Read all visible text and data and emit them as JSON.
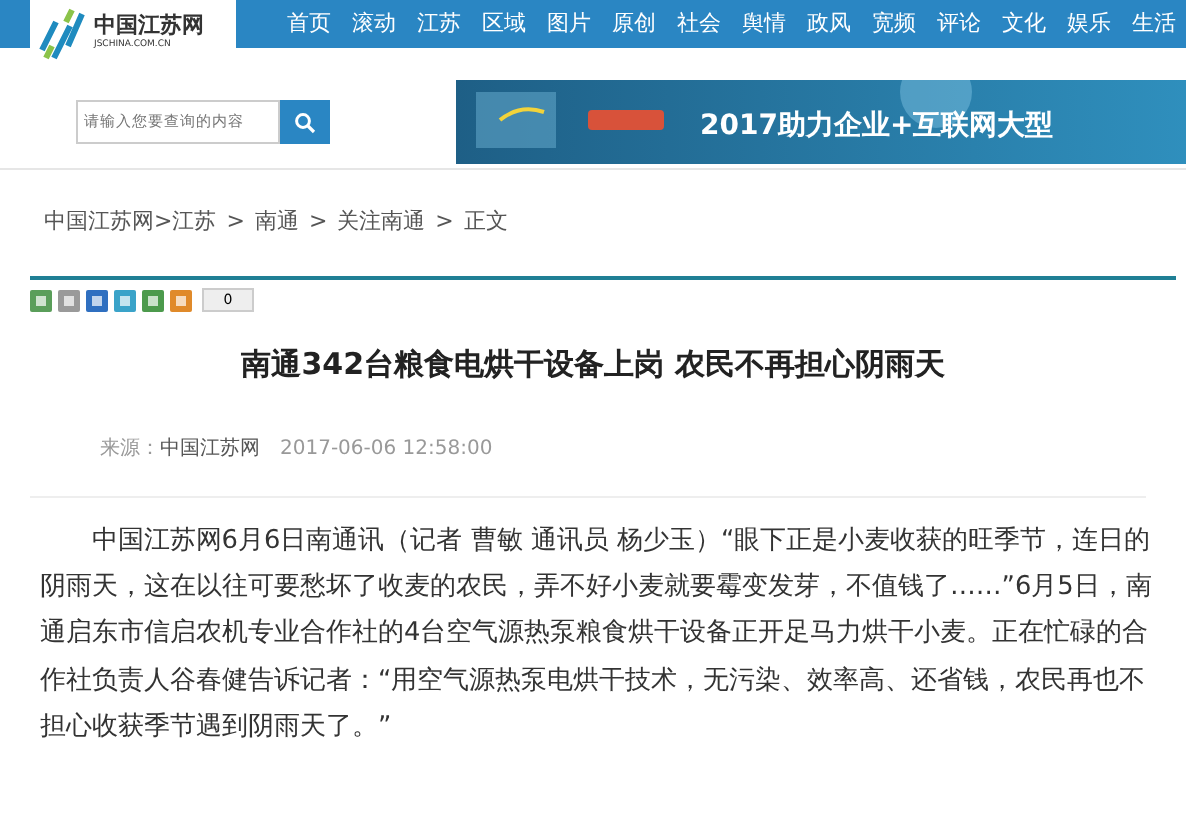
{
  "site": {
    "logo_text": "中国江苏网",
    "logo_domain": "JSCHINA.COM.CN"
  },
  "nav": [
    "首页",
    "滚动",
    "江苏",
    "区域",
    "图片",
    "原创",
    "社会",
    "舆情",
    "政风",
    "宽频",
    "评论",
    "文化",
    "娱乐",
    "生活"
  ],
  "search": {
    "placeholder": "请输入您要查询的内容"
  },
  "banner": {
    "text": "2017助力企业+互联网大型"
  },
  "breadcrumb": [
    {
      "label": "中国江苏网"
    },
    {
      "separator": ">",
      "label": "江苏"
    },
    {
      "separator": ">",
      "label": "南通"
    },
    {
      "separator": ">",
      "label": "关注南通"
    },
    {
      "separator": ">",
      "label": "正文"
    }
  ],
  "share": {
    "count": "0"
  },
  "article": {
    "title": "南通342台粮食电烘干设备上岗 农民不再担心阴雨天",
    "source_label": "来源：",
    "source": "中国江苏网",
    "date": "2017-06-06 12:58:00",
    "body": "中国江苏网6月6日南通讯（记者 曹敏 通讯员 杨少玉）“眼下正是小麦收获的旺季节，连日的阴雨天，这在以往可要愁坏了收麦的农民，弄不好小麦就要霉变发芽，不值钱了……”6月5日，南通启东市信启农机专业合作社的4台空气源热泵粮食烘干设备正开足马力烘干小麦。正在忙碌的合作社负责人谷春健告诉记者：“用空气源热泵电烘干技术，无污染、效率高、还省钱，农民再也不担心收获季节遇到阴雨天了。”"
  }
}
